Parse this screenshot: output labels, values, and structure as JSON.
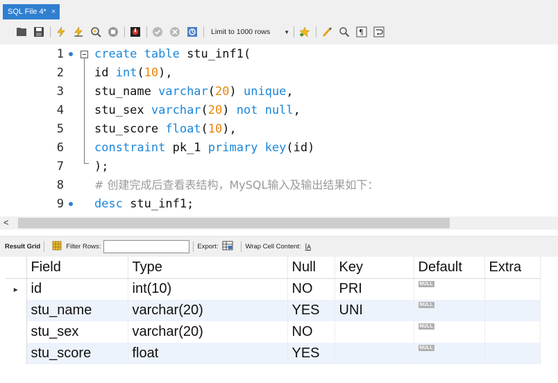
{
  "tab": {
    "title": "SQL File 4*",
    "close": "×"
  },
  "toolbar": {
    "icons": [
      "folder-open-icon",
      "save-icon",
      "execute-icon",
      "execute-current-icon",
      "explain-icon",
      "stop-icon",
      "toggle-continue-icon",
      "commit-icon",
      "rollback-icon",
      "autocommit-icon",
      "bookmark-icon",
      "beautify-icon",
      "find-icon",
      "invisible-chars-icon",
      "wrap-icon"
    ],
    "limit_label": "Limit to 1000 rows"
  },
  "editor": {
    "lines": [
      {
        "n": "1",
        "dot": true
      },
      {
        "n": "2",
        "dot": false
      },
      {
        "n": "3",
        "dot": false
      },
      {
        "n": "4",
        "dot": false
      },
      {
        "n": "5",
        "dot": false
      },
      {
        "n": "6",
        "dot": false
      },
      {
        "n": "7",
        "dot": false
      },
      {
        "n": "8",
        "dot": false
      },
      {
        "n": "9",
        "dot": true
      }
    ],
    "tokens": {
      "l1_kw": "create table",
      "l1_rest": " stu_inf1(",
      "l2_a": "id ",
      "l2_kw": "int",
      "l2_p1": "(",
      "l2_num": "10",
      "l2_p2": "),",
      "l3_a": "stu_name ",
      "l3_kw": "varchar",
      "l3_p1": "(",
      "l3_num": "20",
      "l3_p2": ") ",
      "l3_kw2": "unique",
      "l3_p3": ",",
      "l4_a": "stu_sex ",
      "l4_kw": "varchar",
      "l4_p1": "(",
      "l4_num": "20",
      "l4_p2": ") ",
      "l4_kw2": "not null",
      "l4_p3": ",",
      "l5_a": "stu_score ",
      "l5_kw": "float",
      "l5_p1": "(",
      "l5_num": "10",
      "l5_p2": "),",
      "l6_kw": "constraint",
      "l6_a": " pk_1 ",
      "l6_kw2": "primary key",
      "l6_p": "(id)",
      "l7": ");",
      "l8_comment": "# 创建完成后查看表结构，MySQL输入及输出结果如下：",
      "l9_kw": "desc",
      "l9_rest": " stu_inf1;"
    }
  },
  "scroll": {
    "left_arrow": "<"
  },
  "results_toolbar": {
    "result_grid": "Result Grid",
    "filter_rows": "Filter Rows:",
    "filter_value": "",
    "export": "Export:",
    "wrap": "Wrap Cell Content:",
    "wrap_icon_glyph": "ĪA"
  },
  "grid": {
    "columns": [
      "Field",
      "Type",
      "Null",
      "Key",
      "Default",
      "Extra"
    ],
    "null_badge": "NULL",
    "row_marker": "▸",
    "rows": [
      {
        "field": "id",
        "type": "int(10)",
        "null": "NO",
        "key": "PRI",
        "default": "NULL",
        "extra": ""
      },
      {
        "field": "stu_name",
        "type": "varchar(20)",
        "null": "YES",
        "key": "UNI",
        "default": "NULL",
        "extra": ""
      },
      {
        "field": "stu_sex",
        "type": "varchar(20)",
        "null": "NO",
        "key": "",
        "default": "NULL",
        "extra": ""
      },
      {
        "field": "stu_score",
        "type": "float",
        "null": "YES",
        "key": "",
        "default": "NULL",
        "extra": ""
      }
    ]
  },
  "colors": {
    "keyword": "#1a86d9",
    "number": "#e8850c",
    "comment": "#9a9a9a",
    "tab_active": "#2f7fd0",
    "row_alt": "#edf3fc"
  }
}
